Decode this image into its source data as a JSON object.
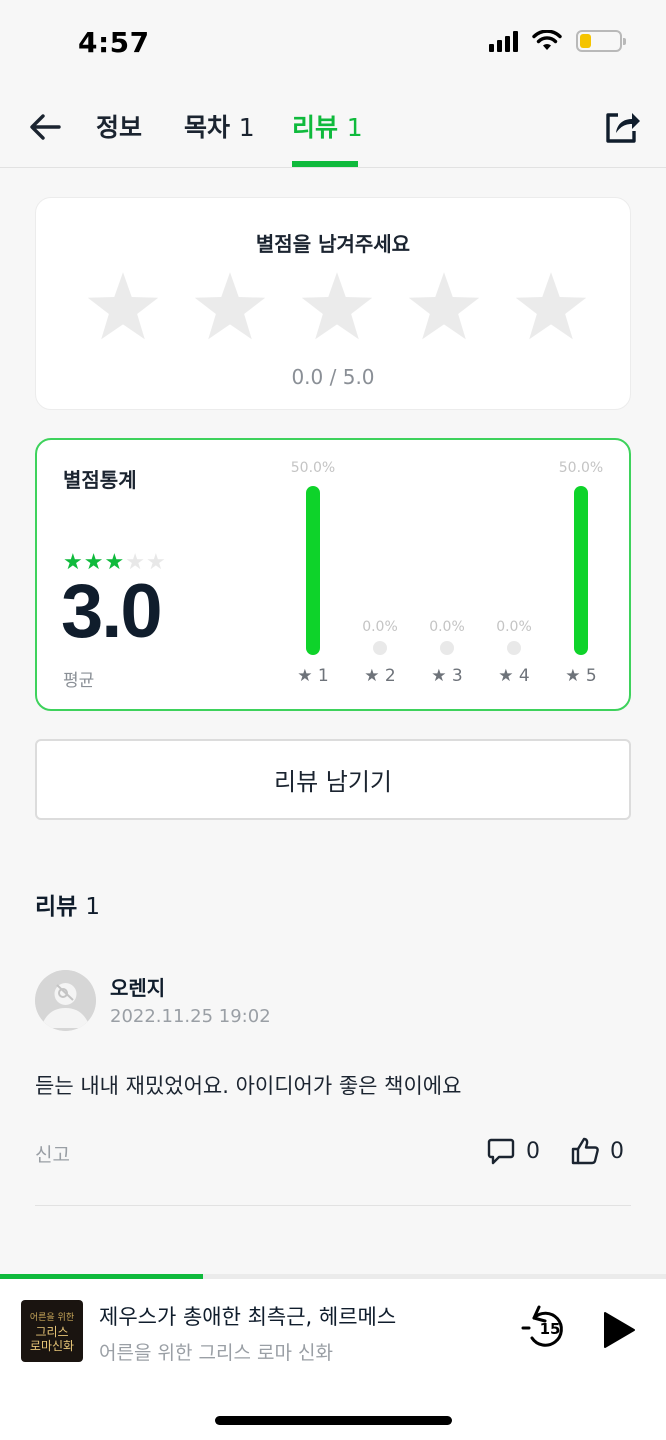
{
  "status_bar": {
    "time": "4:57",
    "battery_level": 0.28
  },
  "nav": {
    "tabs": [
      {
        "label": "정보",
        "count": ""
      },
      {
        "label": "목차",
        "count": "1"
      },
      {
        "label": "리뷰",
        "count": "1"
      }
    ],
    "active_tab": "리뷰",
    "accent_color": "#0fba3c"
  },
  "rating_input": {
    "title": "별점을 남겨주세요",
    "score_text": "0.0 / 5.0",
    "selected": 0,
    "max": 5
  },
  "rating_stats": {
    "title": "별점통계",
    "average": "3.0",
    "average_stars": 3,
    "average_label": "평균",
    "bars": [
      {
        "label": "★ 1",
        "percent_text": "50.0%",
        "fraction": 0.5
      },
      {
        "label": "★ 2",
        "percent_text": "0.0%",
        "fraction": 0
      },
      {
        "label": "★ 3",
        "percent_text": "0.0%",
        "fraction": 0
      },
      {
        "label": "★ 4",
        "percent_text": "0.0%",
        "fraction": 0
      },
      {
        "label": "★ 5",
        "percent_text": "50.0%",
        "fraction": 0.5
      }
    ]
  },
  "write_review_button": "리뷰 남기기",
  "reviews": {
    "heading": "리뷰",
    "count": "1",
    "items": [
      {
        "author": "오렌지",
        "date": "2022.11.25 19:02",
        "text": "듣는 내내 재밌었어요. 아이디어가 좋은 책이에요",
        "report_label": "신고",
        "comment_count": "0",
        "like_count": "0"
      }
    ]
  },
  "player": {
    "title": "제우스가 총애한 최측근, 헤르메스",
    "subtitle": "어른을 위한 그리스 로마 신화",
    "cover_text": {
      "top": "어른을 위한",
      "line1": "그리스",
      "line2": "로마신화"
    },
    "progress": 0.305,
    "rewind_seconds": "15"
  }
}
